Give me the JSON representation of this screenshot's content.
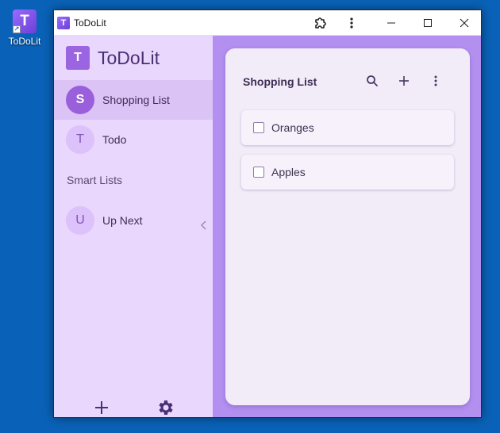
{
  "desktop": {
    "shortcut_label": "ToDoLit",
    "shortcut_letter": "T"
  },
  "window": {
    "title": "ToDoLit",
    "app_letter": "T"
  },
  "sidebar": {
    "brand_letter": "T",
    "brand_name": "ToDoLit",
    "lists": [
      {
        "avatar": "S",
        "label": "Shopping List",
        "active": true
      },
      {
        "avatar": "T",
        "label": "Todo",
        "active": false
      }
    ],
    "smart_section_title": "Smart Lists",
    "smart_lists": [
      {
        "avatar": "U",
        "label": "Up Next"
      }
    ]
  },
  "main": {
    "list_title": "Shopping List",
    "items": [
      {
        "label": "Oranges",
        "checked": false
      },
      {
        "label": "Apples",
        "checked": false
      }
    ]
  },
  "icons": {
    "search": "search-icon",
    "add": "plus-icon",
    "more": "more-vert-icon",
    "settings": "gear-icon",
    "collapse": "chevron-left-icon"
  },
  "colors": {
    "sidebar_bg": "#ead7fd",
    "active_item_bg": "#dcc3f6",
    "main_bg": "#b38ff0",
    "card_bg": "#f2ecf8",
    "accent": "#9a60db",
    "desktop_bg": "#0a62b8"
  }
}
